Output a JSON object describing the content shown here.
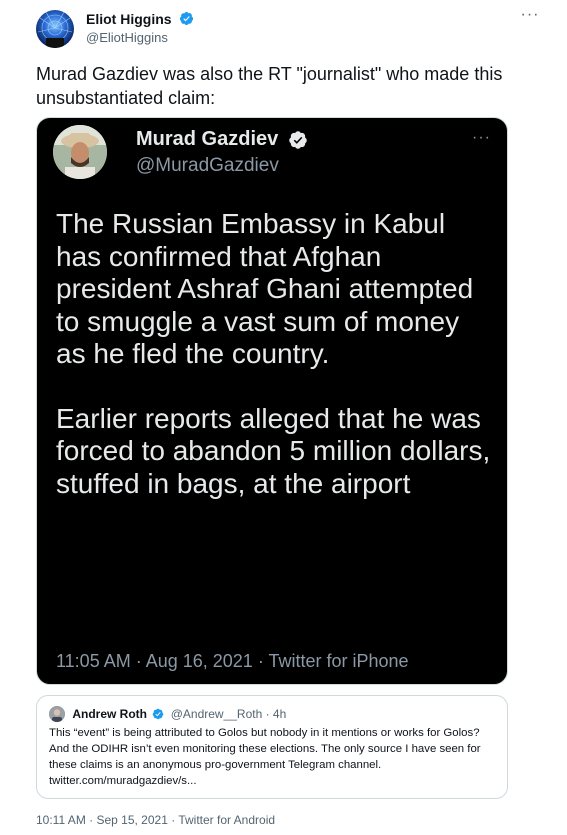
{
  "tweet": {
    "author": {
      "name": "Eliot Higgins",
      "handle": "@EliotHiggins"
    },
    "text": "Murad Gazdiev was also the RT \"journalist\" who made this unsubstantiated claim:",
    "timestamp": "10:11 AM · Sep 15, 2021 · Twitter for Android"
  },
  "media": {
    "author": {
      "name": "Murad Gazdiev",
      "handle": "@MuradGazdiev"
    },
    "paragraph1": "The Russian Embassy in Kabul has confirmed that Afghan president Ashraf Ghani attempted to smuggle a vast sum of money as he fled the country.",
    "paragraph2": "Earlier reports alleged that he was forced to abandon 5 million dollars, stuffed in bags, at the airport",
    "meta": "11:05 AM · Aug 16, 2021 · Twitter for iPhone"
  },
  "quote": {
    "author": {
      "name": "Andrew Roth",
      "handle": "@Andrew__Roth · 4h"
    },
    "text": "This “event” is being attributed to Golos but nobody in it mentions or works for Golos? And the ODIHR isn’t even monitoring these elections. The only source I have seen for these claims is an anonymous pro-government Telegram channel. twitter.com/muradgazdiev/s..."
  },
  "colors": {
    "verified": "#1d9bf0",
    "text": "#0f1419",
    "secondary": "#536471",
    "media_bg": "#000000"
  },
  "icons": {
    "more": "more-horizontal-icon",
    "verified": "verified-badge-icon"
  }
}
